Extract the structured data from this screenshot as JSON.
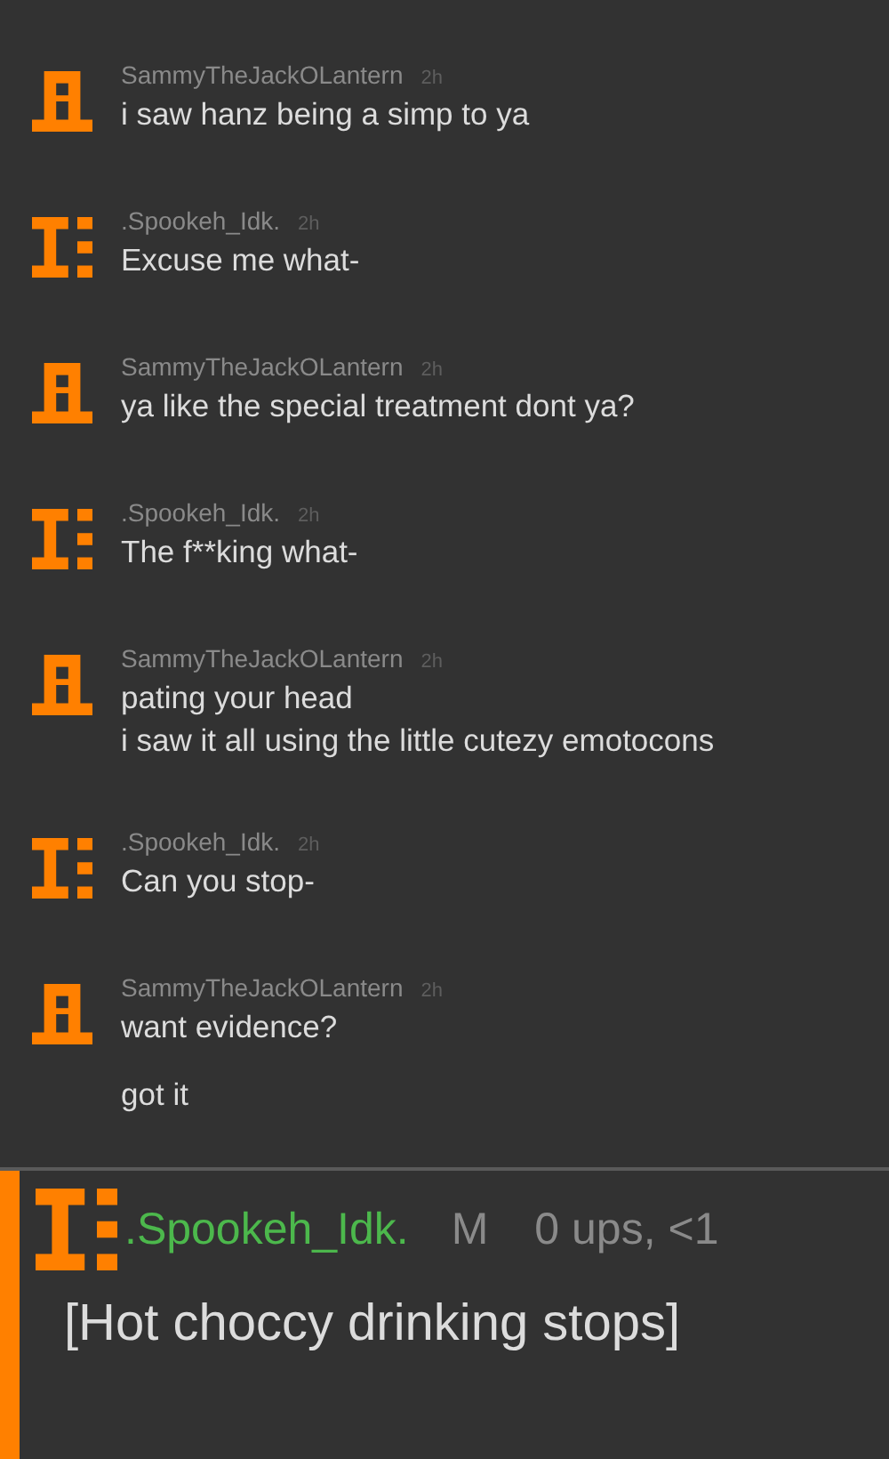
{
  "messages": [
    {
      "kind": "tower",
      "author": "SammyTheJackOLantern",
      "time": "2h",
      "paragraphs": [
        "i saw hanz being a simp to ya"
      ]
    },
    {
      "kind": "beam",
      "author": ".Spookeh_Idk.",
      "time": "2h",
      "paragraphs": [
        "Excuse me what-"
      ]
    },
    {
      "kind": "tower",
      "author": "SammyTheJackOLantern",
      "time": "2h",
      "paragraphs": [
        "ya like the special treatment dont ya?"
      ]
    },
    {
      "kind": "beam",
      "author": ".Spookeh_Idk.",
      "time": "2h",
      "paragraphs": [
        "The f**king what-"
      ]
    },
    {
      "kind": "tower",
      "author": "SammyTheJackOLantern",
      "time": "2h",
      "paragraphs": [
        "pating your head\ni saw it all using the little cutezy emotocons"
      ]
    },
    {
      "kind": "beam",
      "author": ".Spookeh_Idk.",
      "time": "2h",
      "paragraphs": [
        "Can you stop-"
      ]
    },
    {
      "kind": "tower",
      "author": "SammyTheJackOLantern",
      "time": "2h",
      "paragraphs": [
        "want evidence?",
        "got it"
      ]
    }
  ],
  "reply": {
    "kind": "beam",
    "author": ".Spookeh_Idk.",
    "badge": "M",
    "stats": "0 ups, <1",
    "text": "[Hot choccy drinking stops]"
  }
}
